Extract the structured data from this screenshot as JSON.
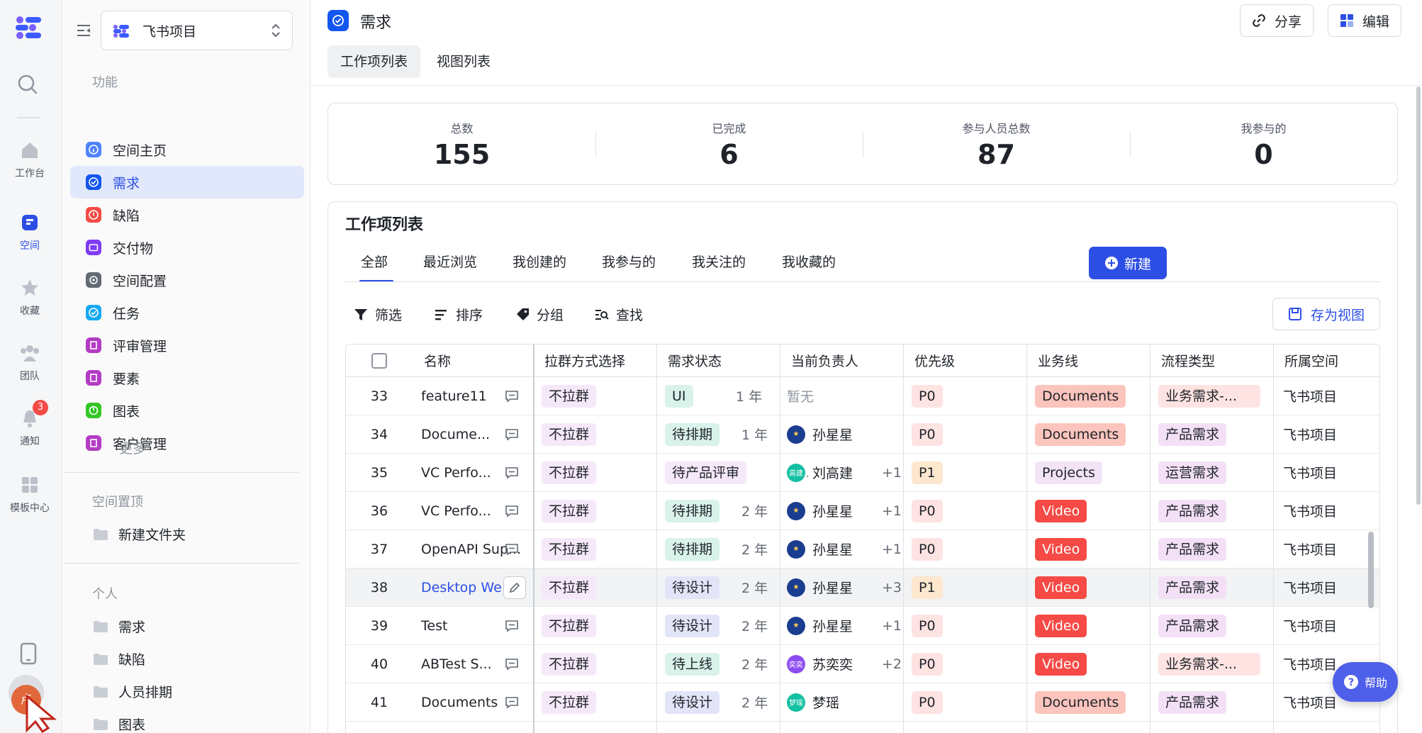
{
  "rail": {
    "items": [
      {
        "label": "工作台",
        "icon": "home-icon"
      },
      {
        "label": "空间",
        "icon": "space-icon"
      },
      {
        "label": "收藏",
        "icon": "star-icon"
      },
      {
        "label": "团队",
        "icon": "team-icon"
      },
      {
        "label": "通知",
        "icon": "bell-icon",
        "badge": "3"
      },
      {
        "label": "模板中心",
        "icon": "template-icon"
      }
    ],
    "avatar_text": "卢"
  },
  "sidebar": {
    "project": "飞书项目",
    "features_heading": "功能",
    "nav": [
      {
        "label": "空间主页",
        "color": "#4e83fd"
      },
      {
        "label": "需求",
        "color": "#1456f0"
      },
      {
        "label": "缺陷",
        "color": "#f54a45"
      },
      {
        "label": "交付物",
        "color": "#7f3bf5"
      },
      {
        "label": "空间配置",
        "color": "#646a73"
      },
      {
        "label": "任务",
        "color": "#14a9f4"
      },
      {
        "label": "评审管理",
        "color": "#b33cc4"
      },
      {
        "label": "要素",
        "color": "#b33cc4"
      },
      {
        "label": "图表",
        "color": "#34c724"
      },
      {
        "label": "客户管理",
        "color": "#b33cc4"
      }
    ],
    "more": "更多",
    "pinned_heading": "空间置顶",
    "pinned_folder": "新建文件夹",
    "personal_heading": "个人",
    "personal_folders": [
      "需求",
      "缺陷",
      "人员排期",
      "图表"
    ]
  },
  "header": {
    "title": "需求",
    "share": "分享",
    "edit": "编辑",
    "tabs": [
      "工作项列表",
      "视图列表"
    ]
  },
  "stats": [
    {
      "label": "总数",
      "value": "155"
    },
    {
      "label": "已完成",
      "value": "6"
    },
    {
      "label": "参与人员总数",
      "value": "87"
    },
    {
      "label": "我参与的",
      "value": "0"
    }
  ],
  "list": {
    "title": "工作项列表",
    "tabs": [
      "全部",
      "最近浏览",
      "我创建的",
      "我参与的",
      "我关注的",
      "我收藏的"
    ],
    "new_button": "新建",
    "tools": [
      "筛选",
      "排序",
      "分组",
      "查找"
    ],
    "save_view": "存为视图",
    "columns": [
      "名称",
      "拉群方式选择",
      "需求状态",
      "当前负责人",
      "优先级",
      "业务线",
      "流程类型",
      "所属空间"
    ],
    "rows": [
      {
        "idx": "33",
        "name": "feature11",
        "group": "不拉群",
        "status": "UI",
        "time": "1 年",
        "owner": "暂无",
        "plus": "",
        "pri": "P0",
        "line": "Documents",
        "flow": "业务需求-...",
        "space": "飞书项目"
      },
      {
        "idx": "34",
        "name": "Docume...",
        "group": "不拉群",
        "status": "待排期",
        "time": "1 年",
        "owner": "孙星星",
        "plus": "",
        "pri": "P0",
        "line": "Documents",
        "flow": "产品需求",
        "space": "飞书项目"
      },
      {
        "idx": "35",
        "name": "VC Perfo...",
        "group": "不拉群",
        "status": "待产品评审",
        "time": "...",
        "owner": "刘高建",
        "plus": "+1",
        "pri": "P1",
        "line": "Projects",
        "flow": "运营需求",
        "space": "飞书项目"
      },
      {
        "idx": "36",
        "name": "VC Perfo...",
        "group": "不拉群",
        "status": "待排期",
        "time": "2 年",
        "owner": "孙星星",
        "plus": "+1",
        "pri": "P0",
        "line": "Video",
        "flow": "产品需求",
        "space": "飞书项目"
      },
      {
        "idx": "37",
        "name": "OpenAPI Sup...",
        "group": "不拉群",
        "status": "待排期",
        "time": "2 年",
        "owner": "孙星星",
        "plus": "+1",
        "pri": "P0",
        "line": "Video",
        "flow": "产品需求",
        "space": "飞书项目"
      },
      {
        "idx": "38",
        "name": "Desktop We",
        "group": "不拉群",
        "status": "待设计",
        "time": "2 年",
        "owner": "孙星星",
        "plus": "+3",
        "pri": "P1",
        "line": "Video",
        "flow": "产品需求",
        "space": "飞书项目"
      },
      {
        "idx": "39",
        "name": "Test",
        "group": "不拉群",
        "status": "待设计",
        "time": "2 年",
        "owner": "孙星星",
        "plus": "+1",
        "pri": "P0",
        "line": "Video",
        "flow": "产品需求",
        "space": "飞书项目"
      },
      {
        "idx": "40",
        "name": "ABTest S...",
        "group": "不拉群",
        "status": "待上线",
        "time": "2 年",
        "owner": "苏奕奕",
        "plus": "+2",
        "pri": "P0",
        "line": "Video",
        "flow": "业务需求-...",
        "space": "飞书项目"
      },
      {
        "idx": "41",
        "name": "Documents",
        "group": "不拉群",
        "status": "待设计",
        "time": "2 年",
        "owner": "梦瑶",
        "plus": "",
        "pri": "P0",
        "line": "Documents",
        "flow": "产品需求",
        "space": "飞书项目"
      }
    ]
  },
  "help": "帮助",
  "colors": {
    "accent": "#2d4ee5",
    "brand": "#1456f0",
    "danger": "#f54a45"
  }
}
